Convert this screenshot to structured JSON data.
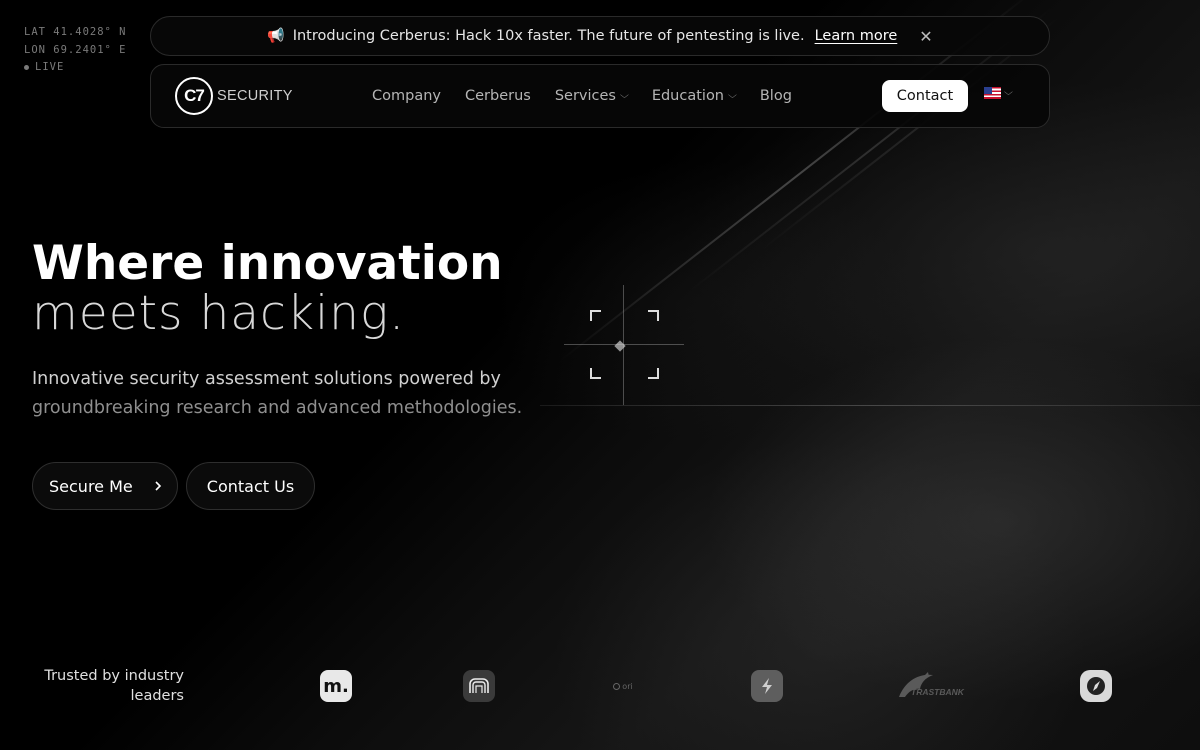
{
  "coords": {
    "lat": "LAT 41.4028° N",
    "lon": "LON 69.2401° E",
    "live": "LIVE"
  },
  "banner": {
    "icon": "megaphone-icon",
    "text": "Introducing Cerberus: Hack 10x faster. The future of pentesting is live.",
    "link": "Learn more",
    "close_icon": "close-icon"
  },
  "nav": {
    "logo_mark": "C7",
    "logo_text": "SECURITY",
    "links": [
      {
        "label": "Company"
      },
      {
        "label": "Cerberus"
      },
      {
        "label": "Services"
      },
      {
        "label": "Education"
      },
      {
        "label": "Blog"
      }
    ],
    "contact": "Contact",
    "language_icon": "us-flag-icon"
  },
  "hero": {
    "title_bold": "Where innovation",
    "title_light": "meets hacking.",
    "subtitle_1": "Innovative security assessment solutions powered by",
    "subtitle_2": "groundbreaking research and advanced methodologies.",
    "cta_primary": "Secure Me",
    "cta_secondary": "Contact Us"
  },
  "trusted": {
    "label": "Trusted by industry leaders",
    "logos": [
      "m-logo",
      "circuit-logo",
      "ori-logo",
      "bolt-logo",
      "trastbank-logo",
      "compass-logo"
    ],
    "ori_text": "ori",
    "trastbank_text": "TRASTBANK",
    "m_text": "m."
  },
  "colors": {
    "background": "#000000",
    "accent": "#ffffff",
    "muted": "#8f8f8f"
  }
}
